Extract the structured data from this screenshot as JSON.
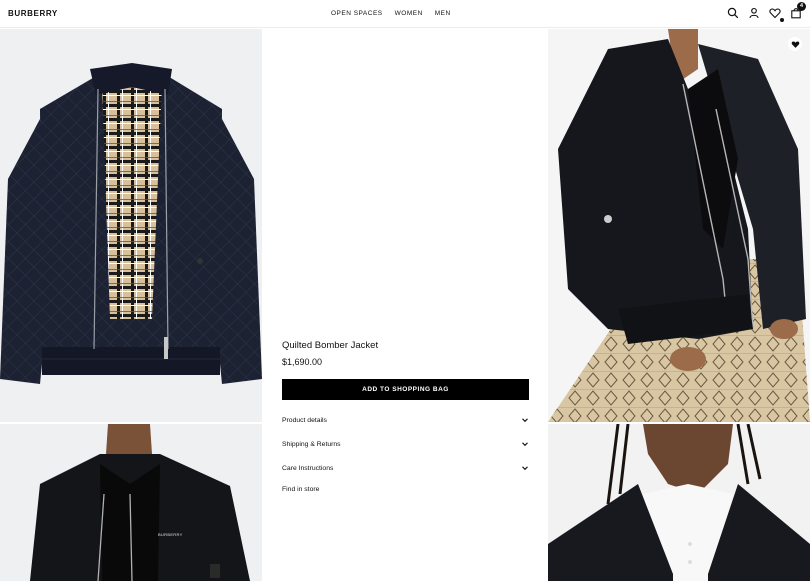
{
  "header": {
    "brand": "BURBERRY",
    "nav": [
      "OPEN SPACES",
      "WOMEN",
      "MEN"
    ],
    "bag_count": "4",
    "icons": [
      "search-icon",
      "account-icon",
      "wishlist-icon",
      "shopping-bag-icon"
    ]
  },
  "product": {
    "title": "Quilted Bomber Jacket",
    "price": "$1,690.00",
    "add_label": "ADD TO SHOPPING BAG",
    "sections": [
      {
        "label": "Product details"
      },
      {
        "label": "Shipping & Returns"
      },
      {
        "label": "Care Instructions"
      }
    ],
    "find_in_store": "Find in store"
  },
  "images": {
    "chest_logo_text": "BURBERRY"
  },
  "colors": {
    "accent": "#000000",
    "panel_bg": "#eef0f2",
    "jacket": "#1c2232",
    "check_beige": "#d8c09a"
  }
}
